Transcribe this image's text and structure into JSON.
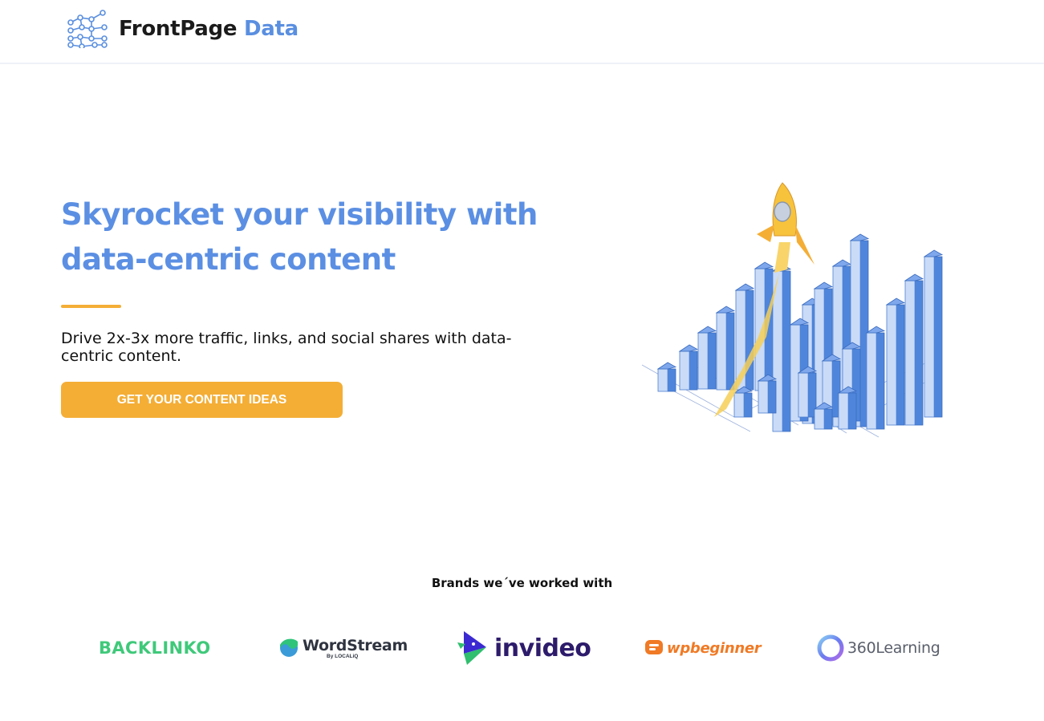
{
  "header": {
    "logo_word1": "FrontPage",
    "logo_word2": "Data",
    "logo_icon": "network-graph-icon"
  },
  "hero": {
    "title": "Skyrocket your visibility with data-centric content",
    "subtitle": "Drive 2x-3x more traffic, links, and social shares with data-centric content.",
    "cta_label": "GET YOUR CONTENT IDEAS",
    "illustration": "rocket-over-bar-chart-illustration"
  },
  "brands": {
    "title": "Brands we´ve worked with",
    "items": [
      {
        "name": "BACKLINKO",
        "icon": "backlinko-logo"
      },
      {
        "name": "WordStream",
        "by": "By LOCALiQ",
        "icon": "wordstream-wave-icon"
      },
      {
        "name": "invideo",
        "icon": "invideo-play-icon"
      },
      {
        "name": "wpbeginner",
        "icon": "wpbeginner-icon"
      },
      {
        "name": "360Learning",
        "icon": "360learning-ring-icon"
      }
    ]
  },
  "colors": {
    "accent_blue": "#5b8fe3",
    "accent_orange": "#f4ae36",
    "text_dark": "#111111",
    "backlinko_green": "#3fc97a",
    "invideo_purple": "#2d1b6b",
    "wpbeginner_orange": "#f07a25"
  }
}
